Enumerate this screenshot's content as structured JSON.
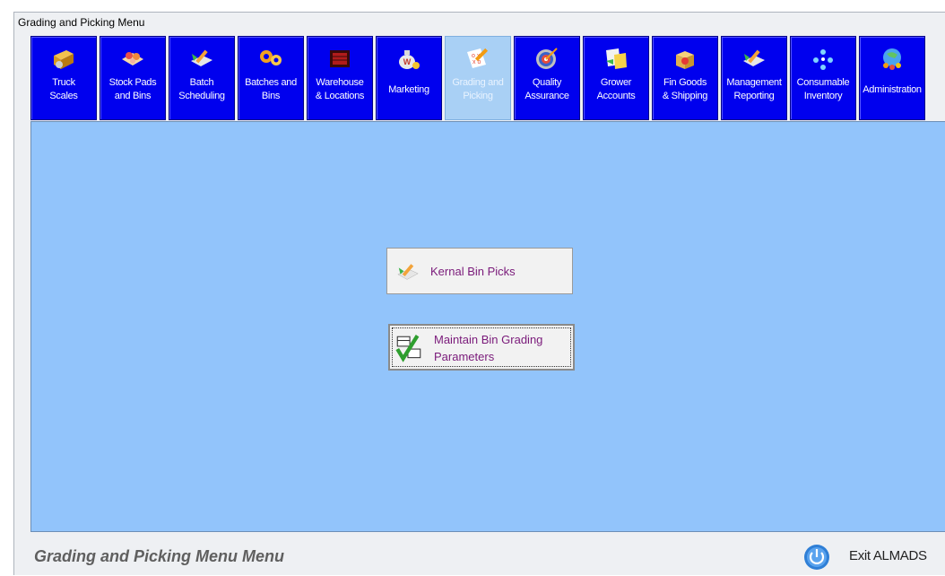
{
  "window": {
    "title": "Grading and Picking Menu"
  },
  "toolbar": {
    "items": [
      {
        "label": "Truck\nScales",
        "icon": "truck-scales-icon",
        "active": false
      },
      {
        "label": "Stock Pads\nand Bins",
        "icon": "stock-pads-icon",
        "active": false
      },
      {
        "label": "Batch\nScheduling",
        "icon": "batch-scheduling-icon",
        "active": false
      },
      {
        "label": "Batches and\nBins",
        "icon": "batches-gears-icon",
        "active": false
      },
      {
        "label": "Warehouse\n& Locations",
        "icon": "warehouse-icon",
        "active": false
      },
      {
        "label": "Marketing",
        "icon": "money-bag-icon",
        "active": false
      },
      {
        "label": "Grading and\nPicking",
        "icon": "grading-picking-icon",
        "active": true
      },
      {
        "label": "Quality\nAssurance",
        "icon": "target-icon",
        "active": false
      },
      {
        "label": "Grower\nAccounts",
        "icon": "grower-accounts-icon",
        "active": false
      },
      {
        "label": "Fin Goods\n& Shipping",
        "icon": "gift-box-icon",
        "active": false
      },
      {
        "label": "Management\nReporting",
        "icon": "report-pen-icon",
        "active": false
      },
      {
        "label": "Consumable\nInventory",
        "icon": "molecule-icon",
        "active": false
      },
      {
        "label": "Administration",
        "icon": "globe-people-icon",
        "active": false
      }
    ]
  },
  "main": {
    "buttons": [
      {
        "label": "Kernal Bin Picks",
        "icon": "pen-paper-icon"
      },
      {
        "label": "Maintain Bin Grading\nParameters",
        "icon": "checkmark-grid-icon"
      }
    ]
  },
  "footer": {
    "title": "Grading and Picking Menu Menu",
    "exit_label": "Exit ALMADS"
  },
  "colors": {
    "toolbar_bg": "#0000ee",
    "toolbar_active_bg": "#a9d0f5",
    "main_bg": "#92c4fb",
    "button_text": "#7a1a7a"
  }
}
